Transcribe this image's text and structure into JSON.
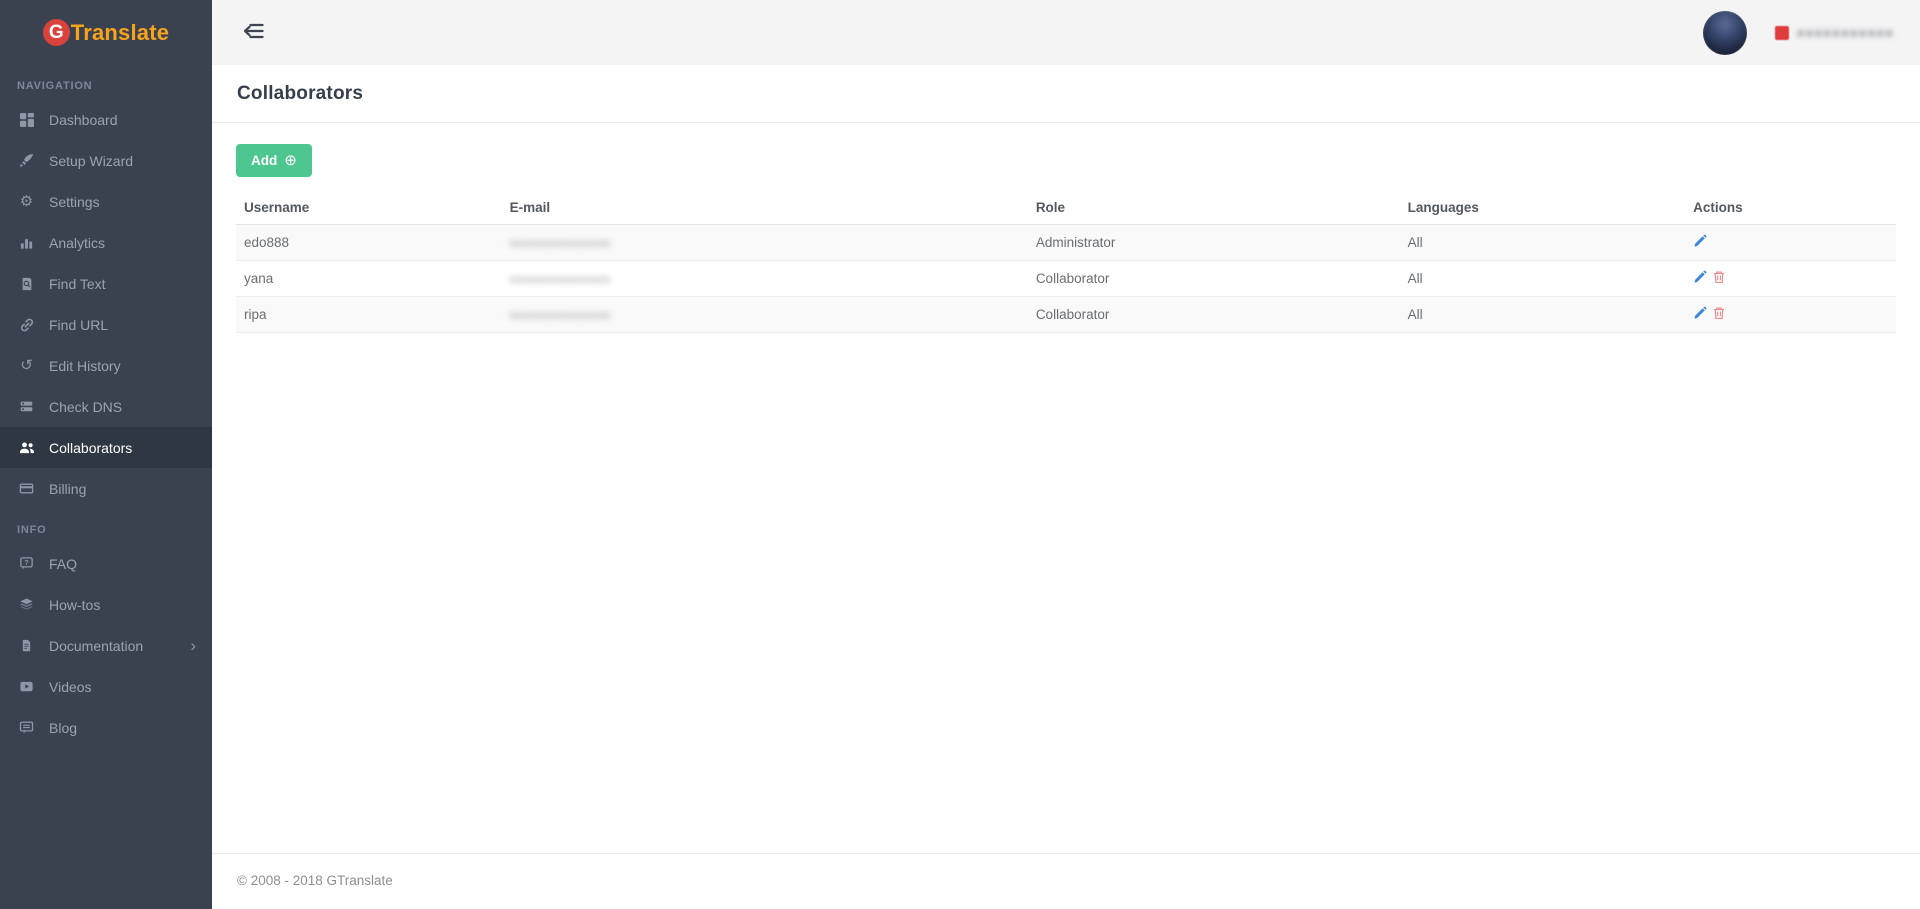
{
  "app": {
    "brand_g": "G",
    "brand_rest": "Translate"
  },
  "topbar": {
    "account_domain_redacted": "●●●●●●●●●●●",
    "account_flag_icon": "red-flag-icon"
  },
  "sidebar": {
    "sections": [
      {
        "label": "NAVIGATION",
        "items": [
          {
            "label": "Dashboard",
            "icon": "dashboard-icon"
          },
          {
            "label": "Setup Wizard",
            "icon": "rocket-icon"
          },
          {
            "label": "Settings",
            "icon": "gear-icon"
          },
          {
            "label": "Analytics",
            "icon": "bar-chart-icon"
          },
          {
            "label": "Find Text",
            "icon": "search-doc-icon"
          },
          {
            "label": "Find URL",
            "icon": "link-icon"
          },
          {
            "label": "Edit History",
            "icon": "history-icon"
          },
          {
            "label": "Check DNS",
            "icon": "server-icon"
          },
          {
            "label": "Collaborators",
            "icon": "users-icon",
            "active": true
          },
          {
            "label": "Billing",
            "icon": "credit-card-icon"
          }
        ]
      },
      {
        "label": "INFO",
        "items": [
          {
            "label": "FAQ",
            "icon": "question-bubble-icon"
          },
          {
            "label": "How-tos",
            "icon": "layers-icon"
          },
          {
            "label": "Documentation",
            "icon": "document-icon",
            "has_submenu": true
          },
          {
            "label": "Videos",
            "icon": "video-icon"
          },
          {
            "label": "Blog",
            "icon": "chat-bubble-icon"
          }
        ]
      }
    ]
  },
  "page": {
    "title": "Collaborators"
  },
  "toolbar": {
    "add_label": "Add",
    "add_icon": "circled-plus-icon"
  },
  "table": {
    "columns": [
      "Username",
      "E-mail",
      "Role",
      "Languages",
      "Actions"
    ],
    "rows": [
      {
        "username": "edo888",
        "email_redacted": "●●●●●●●●●●●●●",
        "role": "Administrator",
        "languages": "All",
        "actions": [
          "edit"
        ]
      },
      {
        "username": "yana",
        "email_redacted": "●●●●●●●●●●●●●",
        "role": "Collaborator",
        "languages": "All",
        "actions": [
          "edit",
          "delete"
        ]
      },
      {
        "username": "ripa",
        "email_redacted": "●●●●●●●●●●●●●",
        "role": "Collaborator",
        "languages": "All",
        "actions": [
          "edit",
          "delete"
        ]
      }
    ]
  },
  "footer": {
    "copyright": "© 2008 - 2018 GTranslate"
  },
  "colors": {
    "sidebar_bg": "#3a4250",
    "sidebar_active_bg": "#2f3742",
    "brand_red": "#d9433c",
    "brand_orange": "#f7a31c",
    "topbar_bg": "#f4f4f5",
    "add_button_green": "#4dc690",
    "edit_icon_blue": "#3e86db",
    "delete_icon_red": "#ec8a8f",
    "flag_red": "#e23d3d",
    "row_stripe": "#f9f9f9",
    "border": "#e9ecee"
  }
}
